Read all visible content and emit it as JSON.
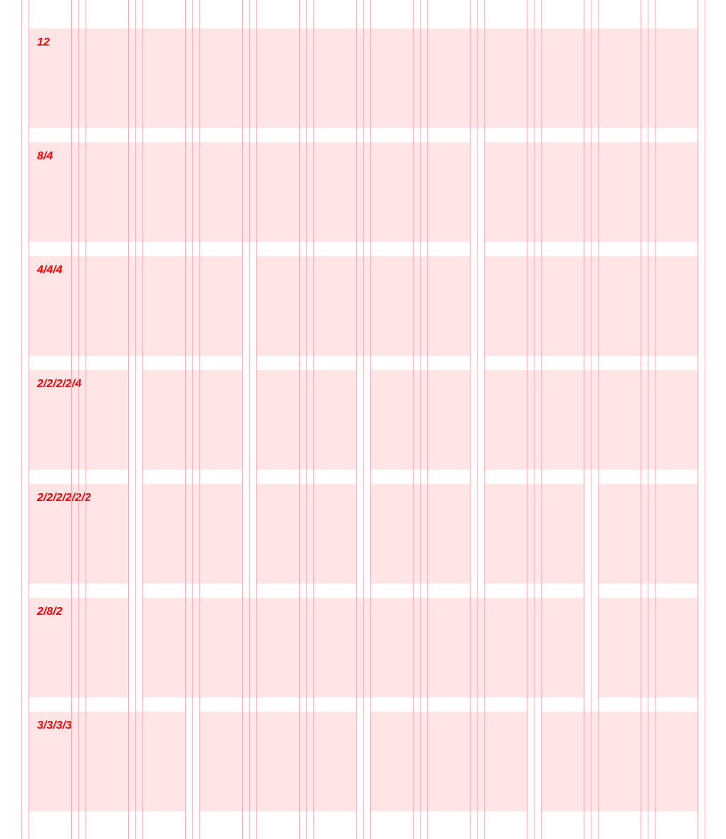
{
  "colors": {
    "cell": "#ffe5e6",
    "guide": "#f3a9b6",
    "label": "#ff0000",
    "background": "#ffffff"
  },
  "grid": {
    "columns": 12
  },
  "rows": [
    {
      "label": "12",
      "spans": [
        12
      ]
    },
    {
      "label": "8/4",
      "spans": [
        8,
        4
      ]
    },
    {
      "label": "4/4/4",
      "spans": [
        4,
        4,
        4
      ]
    },
    {
      "label": "2/2/2/2/4",
      "spans": [
        2,
        2,
        2,
        2,
        4
      ]
    },
    {
      "label": "2/2/2/2/2/2",
      "spans": [
        2,
        2,
        2,
        2,
        2,
        2
      ]
    },
    {
      "label": "2/8/2",
      "spans": [
        2,
        8,
        2
      ]
    },
    {
      "label": "3/3/3/3",
      "spans": [
        3,
        3,
        3,
        3
      ]
    }
  ]
}
